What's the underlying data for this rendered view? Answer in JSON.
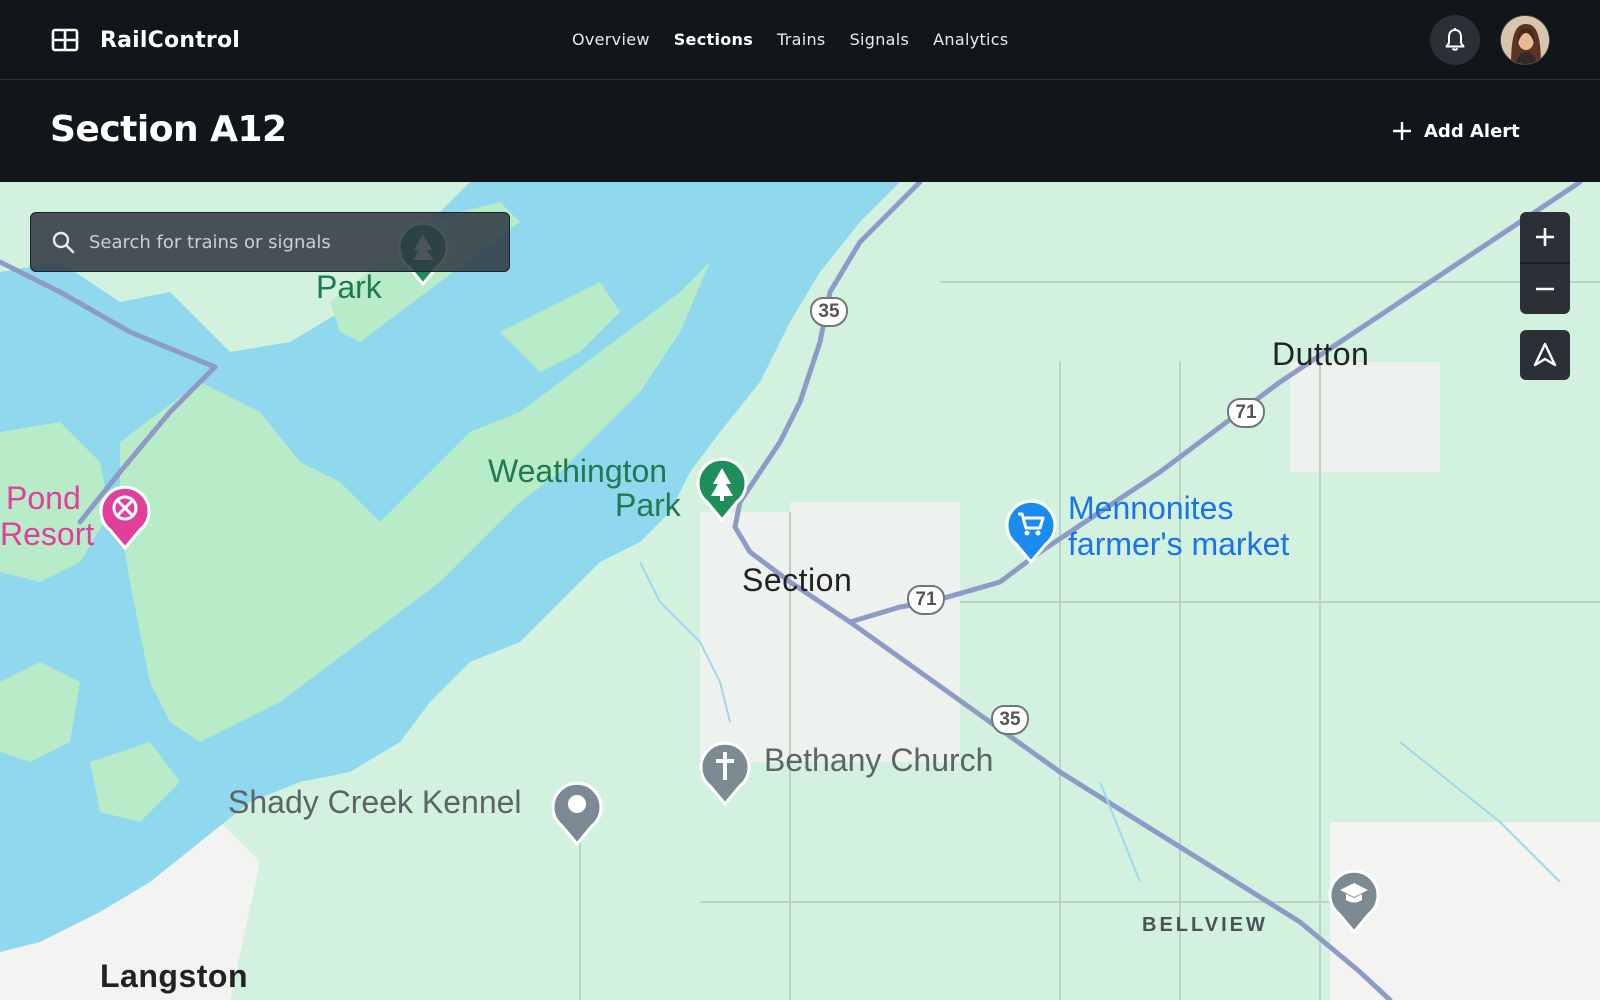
{
  "app": {
    "name": "RailControl",
    "logo_icon": "grid-layout-icon"
  },
  "nav": {
    "items": [
      {
        "label": "Overview",
        "active": false
      },
      {
        "label": "Sections",
        "active": true
      },
      {
        "label": "Trains",
        "active": false
      },
      {
        "label": "Signals",
        "active": false
      },
      {
        "label": "Analytics",
        "active": false
      }
    ]
  },
  "header": {
    "notification_icon": "bell-icon",
    "avatar": "user-avatar"
  },
  "page": {
    "title": "Section A12",
    "add_alert_label": "Add Alert",
    "add_alert_icon": "plus-icon"
  },
  "map": {
    "search": {
      "placeholder": "Search for trains or signals",
      "value": ""
    },
    "controls": {
      "zoom_in": "+",
      "zoom_out": "−",
      "locate_icon": "navigation-arrow-icon"
    },
    "labels": {
      "park_top": "Park",
      "dutton": "Dutton",
      "weathington_line1": "Weathington",
      "weathington_line2": "Park",
      "pond_line1": "Pond",
      "pond_line2": "Resort",
      "mennonites_line1": "Mennonites",
      "mennonites_line2": "farmer's market",
      "section": "Section",
      "bethany": "Bethany Church",
      "shady": "Shady Creek Kennel",
      "bellview": "BELLVIEW",
      "langston": "Langston"
    },
    "route_shields": [
      "35",
      "71",
      "71",
      "35"
    ],
    "colors": {
      "land": "#d2f2df",
      "water": "#8fd8ee",
      "urban": "#f2f4f3",
      "park_pin": "#1e8e5a",
      "shopping_pin": "#1a8cf0",
      "leisure_pin": "#e0409b",
      "generic_pin": "#7c8a94"
    }
  }
}
